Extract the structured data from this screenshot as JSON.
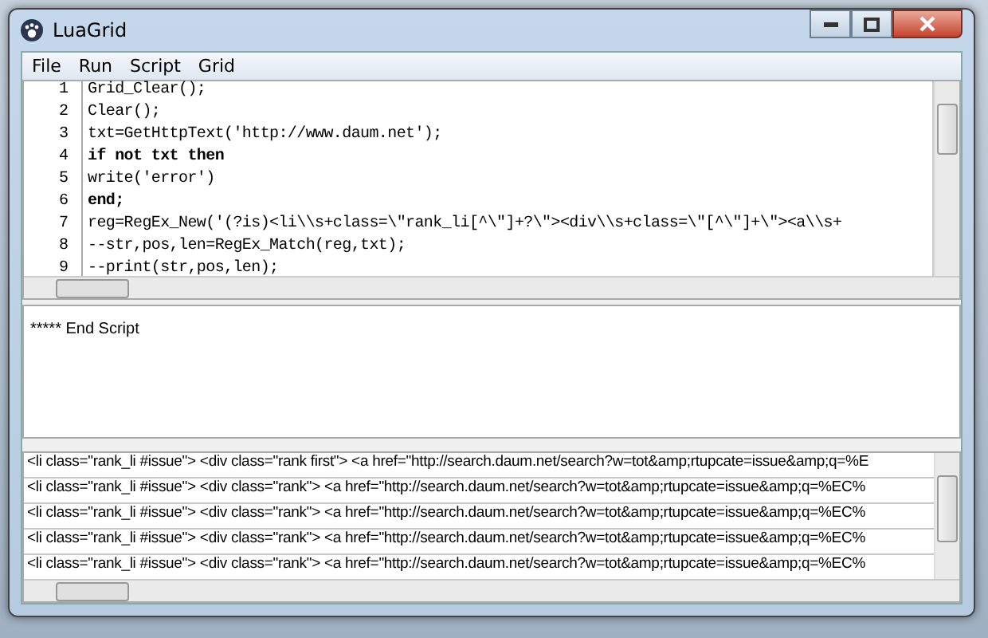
{
  "window": {
    "title": "LuaGrid"
  },
  "menu": [
    "File",
    "Run",
    "Script",
    "Grid"
  ],
  "editor": {
    "lines": [
      {
        "number": "1",
        "text": "Grid_Clear();",
        "bold": false
      },
      {
        "number": "2",
        "text": "Clear();",
        "bold": false
      },
      {
        "number": "3",
        "text": "txt=GetHttpText('http://www.daum.net');",
        "bold": false
      },
      {
        "number": "4",
        "text": "if not txt then",
        "bold": true
      },
      {
        "number": "5",
        "text": "write('error')",
        "bold": false
      },
      {
        "number": "6",
        "text": "end;",
        "bold": true
      },
      {
        "number": "7",
        "text": "reg=RegEx_New('(?is)<li\\\\s+class=\\\"rank_li[^\\\"]+?\\\"><div\\\\s+class=\\\"[^\\\"]+\\\"><a\\\\s+",
        "bold": false
      },
      {
        "number": "8",
        "text": "--str,pos,len=RegEx_Match(reg,txt);",
        "bold": false
      },
      {
        "number": "9",
        "text": "--print(str,pos,len);",
        "bold": false
      }
    ]
  },
  "output": {
    "text": "***** End Script"
  },
  "grid": {
    "rows": [
      "<li class=\"rank_li #issue\"> <div class=\"rank first\"> <a href=\"http://search.daum.net/search?w=tot&amp;rtupcate=issue&amp;q=%E",
      "<li class=\"rank_li #issue\"> <div class=\"rank\"> <a href=\"http://search.daum.net/search?w=tot&amp;rtupcate=issue&amp;q=%EC%",
      "<li class=\"rank_li #issue\"> <div class=\"rank\"> <a href=\"http://search.daum.net/search?w=tot&amp;rtupcate=issue&amp;q=%EC%",
      "<li class=\"rank_li #issue\"> <div class=\"rank\"> <a href=\"http://search.daum.net/search?w=tot&amp;rtupcate=issue&amp;q=%EC%",
      "<li class=\"rank_li #issue\"> <div class=\"rank\"> <a href=\"http://search.daum.net/search?w=tot&amp;rtupcate=issue&amp;q=%EC%"
    ]
  }
}
